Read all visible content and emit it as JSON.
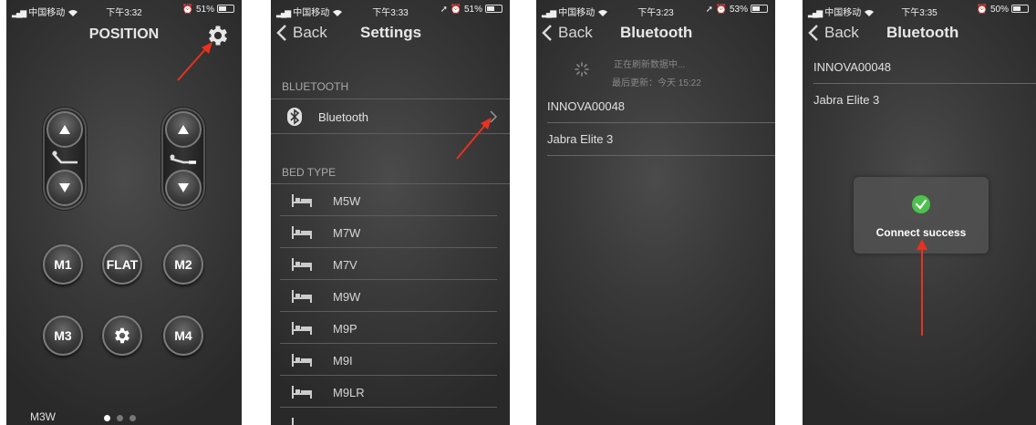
{
  "colors": {
    "arrow": "#e8321e",
    "check": "#4cc24c",
    "background": "#333333"
  },
  "panel1": {
    "status": {
      "carrier": "中国移动",
      "time": "下午3:32",
      "battery": "51%",
      "battery_level": 0.51
    },
    "title": "POSITION",
    "icons": [
      "settings-gear-icon",
      "chevron-up-icon",
      "chevron-down-icon",
      "bed-head-icon",
      "bed-foot-icon"
    ],
    "memory_buttons": {
      "m1": "M1",
      "flat": "FLAT",
      "m2": "M2",
      "m3": "M3",
      "m4": "M4"
    },
    "model": "M3W",
    "pages": {
      "count": 3,
      "current": 1
    }
  },
  "panel2": {
    "status": {
      "carrier": "中国移动",
      "time": "下午3:33",
      "battery": "51%",
      "battery_level": 0.51
    },
    "back": "Back",
    "title": "Settings",
    "bluetooth_header": "BLUETOOTH",
    "bluetooth_label": "Bluetooth",
    "bed_type_header": "BED TYPE",
    "bed_types": [
      "M5W",
      "M7W",
      "M7V",
      "M9W",
      "M9P",
      "M9I",
      "M9LR"
    ]
  },
  "panel3": {
    "status": {
      "carrier": "中国移动",
      "time": "下午3:23",
      "battery": "53%",
      "battery_level": 0.53
    },
    "back": "Back",
    "title": "Bluetooth",
    "refresh_text": "正在刷新数据中...",
    "last_update": "最后更新：今天 15:22",
    "devices": [
      "INNOVA00048",
      "Jabra Elite 3"
    ]
  },
  "panel4": {
    "status": {
      "carrier": "中国移动",
      "time": "下午3:35",
      "battery": "50%",
      "battery_level": 0.5
    },
    "back": "Back",
    "title": "Bluetooth",
    "devices": [
      "INNOVA00048",
      "Jabra Elite 3"
    ],
    "toast": "Connect success"
  }
}
